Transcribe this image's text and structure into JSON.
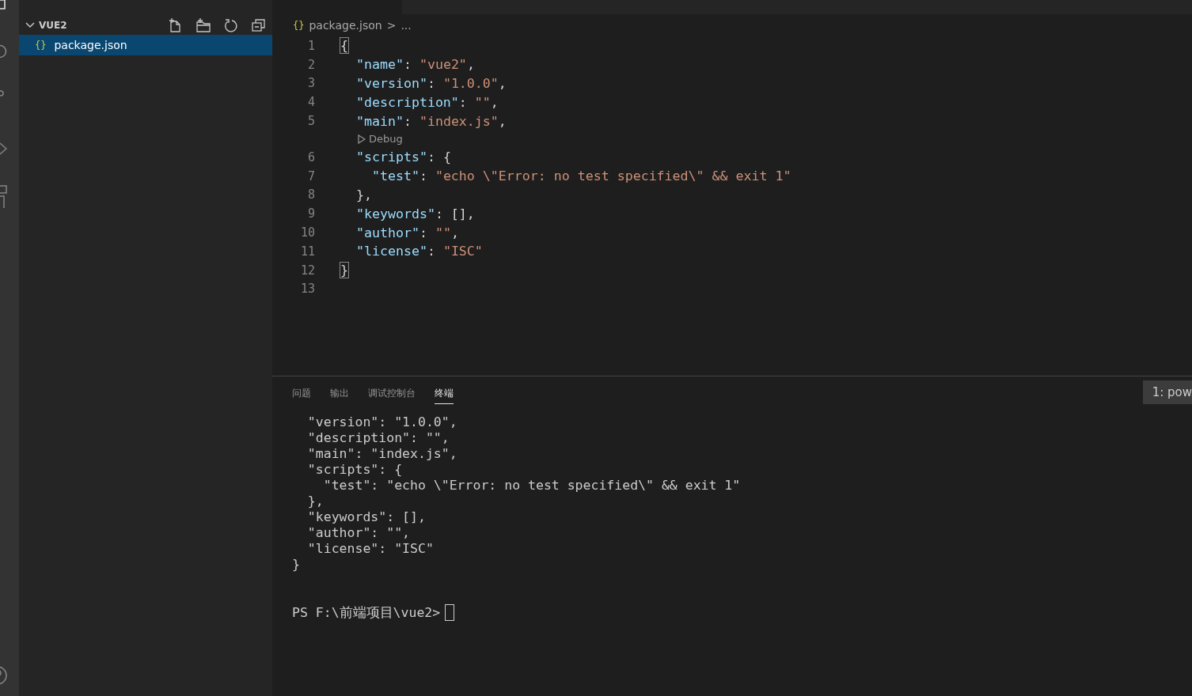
{
  "sidebar": {
    "folder": {
      "label": "VUE2",
      "expanded": true
    },
    "actions": [
      {
        "kind": "new-file"
      },
      {
        "kind": "new-folder"
      },
      {
        "kind": "refresh"
      },
      {
        "kind": "collapse"
      }
    ],
    "files": [
      {
        "icon": "{}",
        "label": "package.json",
        "selected": true
      }
    ]
  },
  "editor": {
    "breadcrumb": {
      "icon": "{}",
      "file": "package.json",
      "separator": ">",
      "rest": "..."
    },
    "lines": [
      {
        "number": "1",
        "tokens": [
          {
            "kind": "bracket-match",
            "text": "{"
          }
        ]
      },
      {
        "number": "2",
        "tokens": [
          {
            "kind": "key",
            "text": "  \"name\""
          },
          {
            "kind": "plain",
            "text": ": "
          },
          {
            "kind": "string",
            "text": "\"vue2\""
          },
          {
            "kind": "plain",
            "text": ","
          }
        ]
      },
      {
        "number": "3",
        "tokens": [
          {
            "kind": "key",
            "text": "  \"version\""
          },
          {
            "kind": "plain",
            "text": ": "
          },
          {
            "kind": "string",
            "text": "\"1.0.0\""
          },
          {
            "kind": "plain",
            "text": ","
          }
        ]
      },
      {
        "number": "4",
        "tokens": [
          {
            "kind": "key",
            "text": "  \"description\""
          },
          {
            "kind": "plain",
            "text": ": "
          },
          {
            "kind": "string",
            "text": "\"\""
          },
          {
            "kind": "plain",
            "text": ","
          }
        ]
      },
      {
        "number": "5",
        "tokens": [
          {
            "kind": "key",
            "text": "  \"main\""
          },
          {
            "kind": "plain",
            "text": ": "
          },
          {
            "kind": "string",
            "text": "\"index.js\""
          },
          {
            "kind": "plain",
            "text": ","
          }
        ],
        "codelens": "Debug"
      },
      {
        "number": "6",
        "tokens": [
          {
            "kind": "key",
            "text": "  \"scripts\""
          },
          {
            "kind": "plain",
            "text": ": {"
          }
        ]
      },
      {
        "number": "7",
        "tokens": [
          {
            "kind": "key",
            "text": "    \"test\""
          },
          {
            "kind": "plain",
            "text": ": "
          },
          {
            "kind": "string",
            "text": "\"echo \\\"Error: no test specified\\\" && exit 1\""
          }
        ]
      },
      {
        "number": "8",
        "tokens": [
          {
            "kind": "plain",
            "text": "  },"
          }
        ]
      },
      {
        "number": "9",
        "tokens": [
          {
            "kind": "key",
            "text": "  \"keywords\""
          },
          {
            "kind": "plain",
            "text": ": [],"
          }
        ]
      },
      {
        "number": "10",
        "tokens": [
          {
            "kind": "key",
            "text": "  \"author\""
          },
          {
            "kind": "plain",
            "text": ": "
          },
          {
            "kind": "string",
            "text": "\"\""
          },
          {
            "kind": "plain",
            "text": ","
          }
        ]
      },
      {
        "number": "11",
        "tokens": [
          {
            "kind": "key",
            "text": "  \"license\""
          },
          {
            "kind": "plain",
            "text": ": "
          },
          {
            "kind": "string",
            "text": "\"ISC\""
          }
        ]
      },
      {
        "number": "12",
        "tokens": [
          {
            "kind": "bracket-match",
            "text": "}"
          }
        ]
      },
      {
        "number": "13"
      }
    ]
  },
  "panel": {
    "tabs": [
      {
        "label": "问题",
        "selected": false
      },
      {
        "label": "输出",
        "selected": false
      },
      {
        "label": "调试控制台",
        "selected": false
      },
      {
        "label": "终端",
        "selected": true
      }
    ],
    "terminal_picker": "1: pow",
    "terminal_lines": [
      "  \"version\": \"1.0.0\",",
      "  \"description\": \"\",",
      "  \"main\": \"index.js\",",
      "  \"scripts\": {",
      "    \"test\": \"echo \\\"Error: no test specified\\\" && exit 1\"",
      "  },",
      "  \"keywords\": [],",
      "  \"author\": \"\",",
      "  \"license\": \"ISC\"",
      "}"
    ],
    "prompt": "PS F:\\前端项目\\vue2>"
  }
}
